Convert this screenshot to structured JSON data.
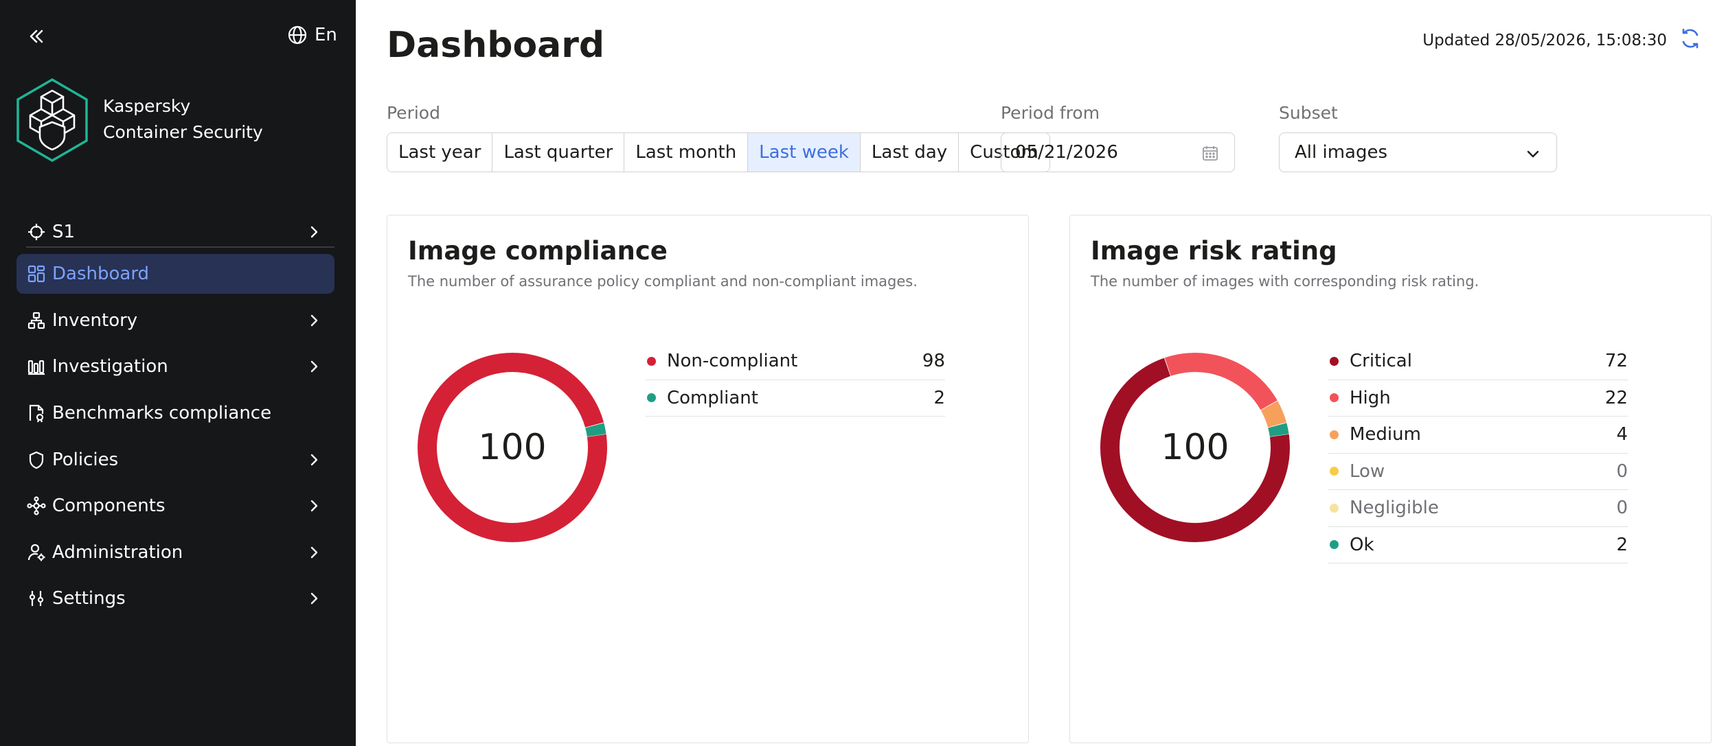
{
  "sidebar": {
    "language": "En",
    "brand_line1": "Kaspersky",
    "brand_line2": "Container Security",
    "cluster": "S1",
    "items": [
      {
        "label": "Dashboard",
        "icon": "dashboard-icon",
        "active": true
      },
      {
        "label": "Inventory",
        "icon": "inventory-icon"
      },
      {
        "label": "Investigation",
        "icon": "investigation-icon"
      },
      {
        "label": "Benchmarks compliance",
        "icon": "benchmarks-icon"
      },
      {
        "label": "Policies",
        "icon": "shield-icon"
      },
      {
        "label": "Components",
        "icon": "components-icon"
      },
      {
        "label": "Administration",
        "icon": "admin-user-icon"
      },
      {
        "label": "Settings",
        "icon": "settings-sliders-icon"
      }
    ]
  },
  "header": {
    "title": "Dashboard",
    "updated": "Updated 28/05/2026, 15:08:30"
  },
  "filters": {
    "period_label": "Period",
    "periods": [
      "Last year",
      "Last quarter",
      "Last month",
      "Last week",
      "Last day",
      "Custom"
    ],
    "selected_period": "Last week",
    "period_from_label": "Period from",
    "period_from_value": "05/21/2026",
    "subset_label": "Subset",
    "subset_value": "All images"
  },
  "cards": {
    "compliance": {
      "title": "Image compliance",
      "subtitle": "The number of assurance policy compliant and non-compliant images.",
      "total": "100"
    },
    "risk": {
      "title": "Image risk rating",
      "subtitle": "The number of images with corresponding risk rating.",
      "total": "100"
    }
  },
  "colors": {
    "sidebar_bg": "#161719",
    "accent": "#3d6ee0",
    "non_compliant": "#d42136",
    "compliant": "#1f9e84",
    "critical": "#a10f25",
    "high": "#f2535a",
    "medium": "#f7a05c",
    "low": "#f5ce46",
    "negligible": "#f7e39c",
    "ok": "#1f9e84"
  },
  "chart_data": [
    {
      "type": "pie",
      "title": "Image compliance",
      "categories": [
        "Non-compliant",
        "Compliant"
      ],
      "values": [
        98,
        2
      ],
      "colors": [
        "#d42136",
        "#1f9e84"
      ]
    },
    {
      "type": "pie",
      "title": "Image risk rating",
      "categories": [
        "Critical",
        "High",
        "Medium",
        "Low",
        "Negligible",
        "Ok"
      ],
      "values": [
        72,
        22,
        4,
        0,
        0,
        2
      ],
      "colors": [
        "#a10f25",
        "#f2535a",
        "#f7a05c",
        "#f5ce46",
        "#f7e39c",
        "#1f9e84"
      ]
    }
  ]
}
